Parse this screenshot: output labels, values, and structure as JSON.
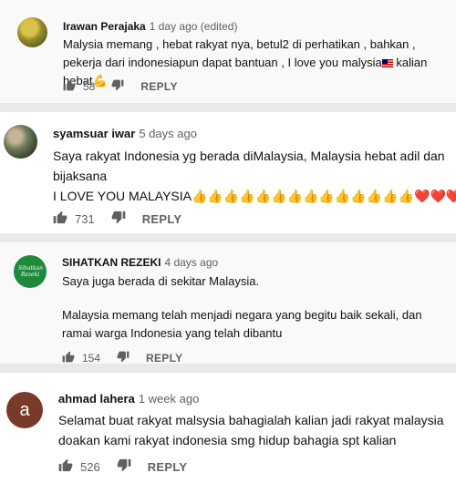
{
  "comments": [
    {
      "author": "Irawan Perajaka",
      "time": "1 day ago (edited)",
      "text_before_flag": "Malysia memang , hebat rakyat nya, betul2 di perhatikan , bahkan , pekerja dari indonesiapun dapat bantuan , I love you malysia",
      "text_after_flag": " kalian hebat💪",
      "likes": "58",
      "reply": "REPLY"
    },
    {
      "author": "syamsuar iwar",
      "time": "5 days ago",
      "text_line1": "Saya rakyat Indonesia yg berada diMalaysia,  Malaysia hebat adil dan bijaksana",
      "text_line2": " I LOVE YOU MALAYSIA👍👍👍👍👍👍👍👍👍👍👍👍👍👍❤️❤️❤️",
      "likes": "731",
      "reply": "REPLY"
    },
    {
      "author": "SIHATKAN REZEKI",
      "time": "4 days ago",
      "avatar_text": "Sihatkan Rezeki",
      "text_para1": "Saya juga berada di sekitar Malaysia.",
      "text_para2": "Malaysia memang telah menjadi negara yang begitu baik sekali, dan ramai warga Indonesia yang telah dibantu",
      "likes": "154",
      "reply": "REPLY"
    },
    {
      "author": "ahmad lahera",
      "time": "1 week ago",
      "avatar_letter": "a",
      "text": "Selamat buat rakyat malsysia bahagialah kalian jadi rakyat malaysia doakan kami rakyat indonesia smg hidup bahagia spt kalian",
      "likes": "526",
      "reply": "REPLY"
    }
  ],
  "colors": {
    "sihatkan_green": "#1e8a3c",
    "ahmad_avatar": "#7a3a2a"
  }
}
